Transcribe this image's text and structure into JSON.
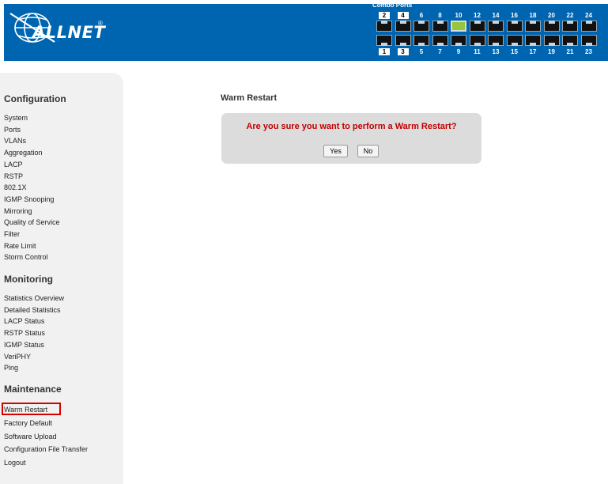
{
  "header": {
    "logo_text": "ALLNET",
    "logo_mark": "®",
    "combo_ports_label": "Combo Ports",
    "brand_color": "#0065b0",
    "ports_top": [
      "2",
      "4",
      "6",
      "8",
      "10",
      "12",
      "14",
      "16",
      "18",
      "20",
      "22",
      "24"
    ],
    "ports_bottom": [
      "1",
      "3",
      "5",
      "7",
      "9",
      "11",
      "13",
      "15",
      "17",
      "19",
      "21",
      "23"
    ],
    "active_port": "10",
    "active_port_color": "#99c43e"
  },
  "sidebar": {
    "configuration": {
      "heading": "Configuration",
      "items": [
        "System",
        "Ports",
        "VLANs",
        "Aggregation",
        "LACP",
        "RSTP",
        "802.1X",
        "IGMP Snooping",
        "Mirroring",
        "Quality of Service",
        "Filter",
        "Rate Limit",
        "Storm Control"
      ]
    },
    "monitoring": {
      "heading": "Monitoring",
      "items": [
        "Statistics Overview",
        "Detailed Statistics",
        "LACP Status",
        "RSTP Status",
        "IGMP Status",
        "VeriPHY",
        "Ping"
      ]
    },
    "maintenance": {
      "heading": "Maintenance",
      "items": [
        "Warm Restart",
        "Factory Default",
        "Software Upload",
        "Configuration File Transfer",
        "Logout"
      ],
      "selected": "Warm Restart",
      "selected_color": "#d40000"
    }
  },
  "main": {
    "title": "Warm Restart",
    "dialog": {
      "message": "Are you sure you want to perform a Warm Restart?",
      "message_color": "#c00000",
      "yes_label": "Yes",
      "no_label": "No"
    }
  }
}
